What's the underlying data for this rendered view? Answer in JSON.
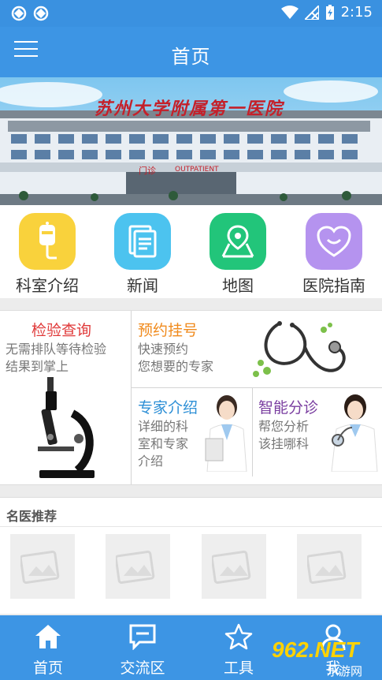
{
  "status_bar": {
    "time": "2:15"
  },
  "app_bar": {
    "title": "首页"
  },
  "banner": {
    "sign_text": "苏州大学附属第一医院",
    "door_cn": "门诊",
    "door_en": "OUTPATIENT"
  },
  "quick_menu": [
    {
      "label": "科室介绍",
      "icon": "iv-drip-icon",
      "color": "#f9d23c"
    },
    {
      "label": "新闻",
      "icon": "document-icon",
      "color": "#4cc3ef"
    },
    {
      "label": "地图",
      "icon": "map-icon",
      "color": "#22c57a"
    },
    {
      "label": "医院指南",
      "icon": "heart-chat-icon",
      "color": "#b593ef"
    }
  ],
  "services": {
    "lab": {
      "title": "检验查询",
      "desc1": "无需排队等待检验",
      "desc2": "结果到掌上",
      "color": "#e03a3a"
    },
    "appointment": {
      "title": "预约挂号",
      "desc1": "快速预约",
      "desc2": "您想要的专家",
      "color": "#f08a1c"
    },
    "experts": {
      "title": "专家介绍",
      "desc1": "详细的科",
      "desc2": "室和专家",
      "desc3": "介绍",
      "color": "#2d8fd6"
    },
    "triage": {
      "title": "智能分诊",
      "desc1": "帮您分析",
      "desc2": "该挂哪科",
      "color": "#7a3ea0"
    }
  },
  "doctors": {
    "header": "名医推荐"
  },
  "bottom_nav": [
    {
      "label": "首页",
      "icon": "home-icon"
    },
    {
      "label": "交流区",
      "icon": "chat-icon"
    },
    {
      "label": "工具",
      "icon": "star-icon"
    },
    {
      "label": "我",
      "icon": "user-icon"
    }
  ],
  "watermark": {
    "brand": "962.NET",
    "sub": "乐游网"
  }
}
